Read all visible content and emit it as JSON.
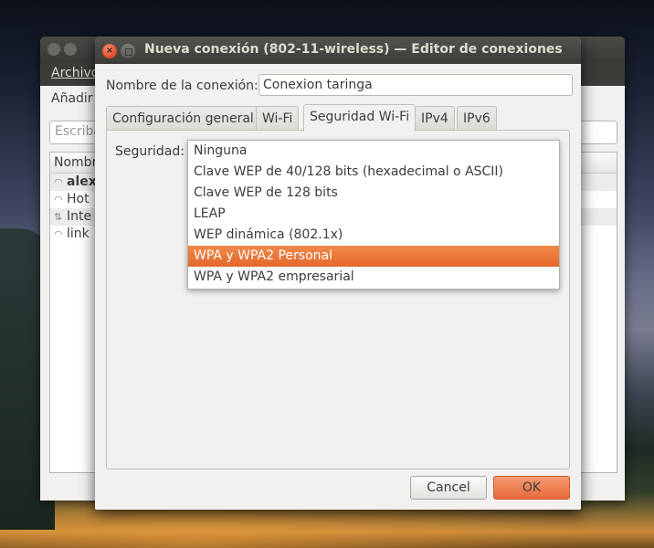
{
  "background_window": {
    "menu": "Archivo",
    "toolbar": "Añadir",
    "search_placeholder": "Escriba",
    "list_header": "Nombre",
    "rows": [
      {
        "label": "alex",
        "icon": "wifi-icon",
        "bold": true
      },
      {
        "label": "Hot",
        "icon": "wifi-icon",
        "bold": false
      },
      {
        "label": "Inte",
        "icon": "ethernet-icon",
        "bold": false
      },
      {
        "label": "link",
        "icon": "wifi-icon",
        "bold": false
      }
    ]
  },
  "dialog": {
    "title": "Nueva conexión (802-11-wireless) — Editor de conexiones",
    "close_symbol": "×",
    "name_label": "Nombre de la conexión:",
    "name_value": "Conexion taringa",
    "tabs": [
      {
        "label": "Configuración general",
        "active": false
      },
      {
        "label": "Wi-Fi",
        "active": false
      },
      {
        "label": "Seguridad Wi-Fi",
        "active": true
      },
      {
        "label": "IPv4",
        "active": false
      },
      {
        "label": "IPv6",
        "active": false
      }
    ],
    "security_label": "Seguridad:",
    "security_options": [
      "Ninguna",
      "Clave WEP de 40/128 bits (hexadecimal o ASCII)",
      "Clave WEP de 128 bits",
      "LEAP",
      "WEP dinámica (802.1x)",
      "WPA y WPA2 Personal",
      "WPA y WPA2 empresarial"
    ],
    "selected_option": "WPA y WPA2 Personal",
    "cancel_label": "Cancel",
    "ok_label": "OK",
    "accent_color": "#e86a3a"
  }
}
